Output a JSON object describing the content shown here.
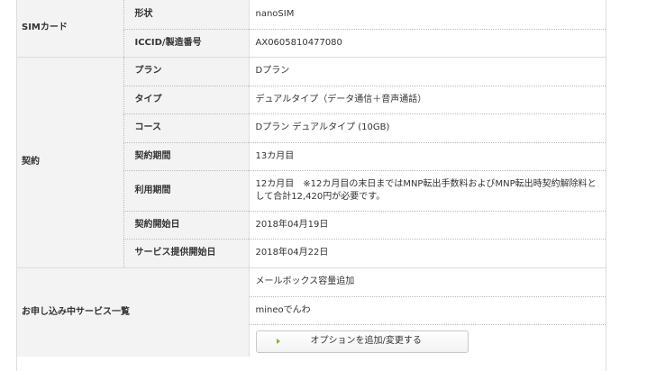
{
  "sim_card": {
    "group_label": "SIMカード",
    "rows": [
      {
        "label": "形状",
        "value": "nanoSIM"
      },
      {
        "label": "ICCID/製造番号",
        "value": "AX0605810477080"
      }
    ]
  },
  "contract": {
    "group_label": "契約",
    "rows": [
      {
        "label": "プラン",
        "value": "Dプラン"
      },
      {
        "label": "タイプ",
        "value": "デュアルタイプ（データ通信＋音声通話）"
      },
      {
        "label": "コース",
        "value": "Dプラン デュアルタイプ (10GB)"
      },
      {
        "label": "契約期間",
        "value": "13カ月目"
      },
      {
        "label": "利用期間",
        "value": "12カ月目　※12カ月目の末日まではMNP転出手数料およびMNP転出時契約解除料として合計12,420円が必要です。"
      },
      {
        "label": "契約開始日",
        "value": "2018年04月19日"
      },
      {
        "label": "サービス提供開始日",
        "value": "2018年04月22日"
      }
    ]
  },
  "services": {
    "group_label": "お申し込み中サービス一覧",
    "items": [
      "メールボックス容量追加",
      "mineoでんわ"
    ],
    "button_label": "オプションを追加/変更する"
  },
  "colors": {
    "label_bg": "#f3f3f3",
    "border": "#dddddd",
    "arrow": "#6fbf2f"
  }
}
